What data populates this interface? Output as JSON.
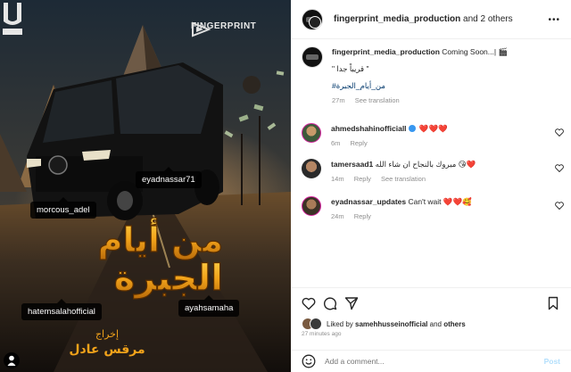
{
  "poster": {
    "brand_name": "FINGERPRINT",
    "brand_sub": "",
    "logo_letter": "U",
    "title_line1": "من أيام",
    "title_line2": "الجبرة",
    "credit_small": "إخراج",
    "credit_name": "مرقس عادل",
    "tags": [
      "morcous_adel",
      "eyadnassar71",
      "hatemsalahofficial",
      "ayahsamaha"
    ]
  },
  "header": {
    "username": "fingerprint_media_production",
    "suffix": "and 2 others",
    "more_icon": "more-horizontal-icon"
  },
  "caption": {
    "username": "fingerprint_media_production",
    "text": "Coming Soon...|",
    "emoji": "🎬",
    "line2": "\" قريباً جدا \"",
    "hashtag": "#من_أيام_الجبرة",
    "time": "27m",
    "translation": "See translation"
  },
  "comments": [
    {
      "username": "ahmedshahinofficiall",
      "verified": true,
      "text": "❤️❤️❤️",
      "time": "6m",
      "reply": "Reply",
      "translation": ""
    },
    {
      "username": "tamersaad1",
      "verified": false,
      "text": "مبروك بالنجاح ان شاء الله 😘❤️",
      "time": "14m",
      "reply": "Reply",
      "translation": "See translation"
    },
    {
      "username": "eyadnassar_updates",
      "verified": false,
      "text": "Can't wait ❤️❤️🥰",
      "time": "24m",
      "reply": "Reply",
      "translation": ""
    }
  ],
  "likes": {
    "prefix": "Liked by",
    "user": "samehhusseinofficial",
    "suffix": "and",
    "others": "others"
  },
  "post_time": "27 minutes ago",
  "add_comment": {
    "placeholder": "Add a comment...",
    "post_label": "Post"
  },
  "colors": {
    "accent": "#0095f6",
    "heart": "#ed4956",
    "title_gold": "#f2b51e"
  }
}
